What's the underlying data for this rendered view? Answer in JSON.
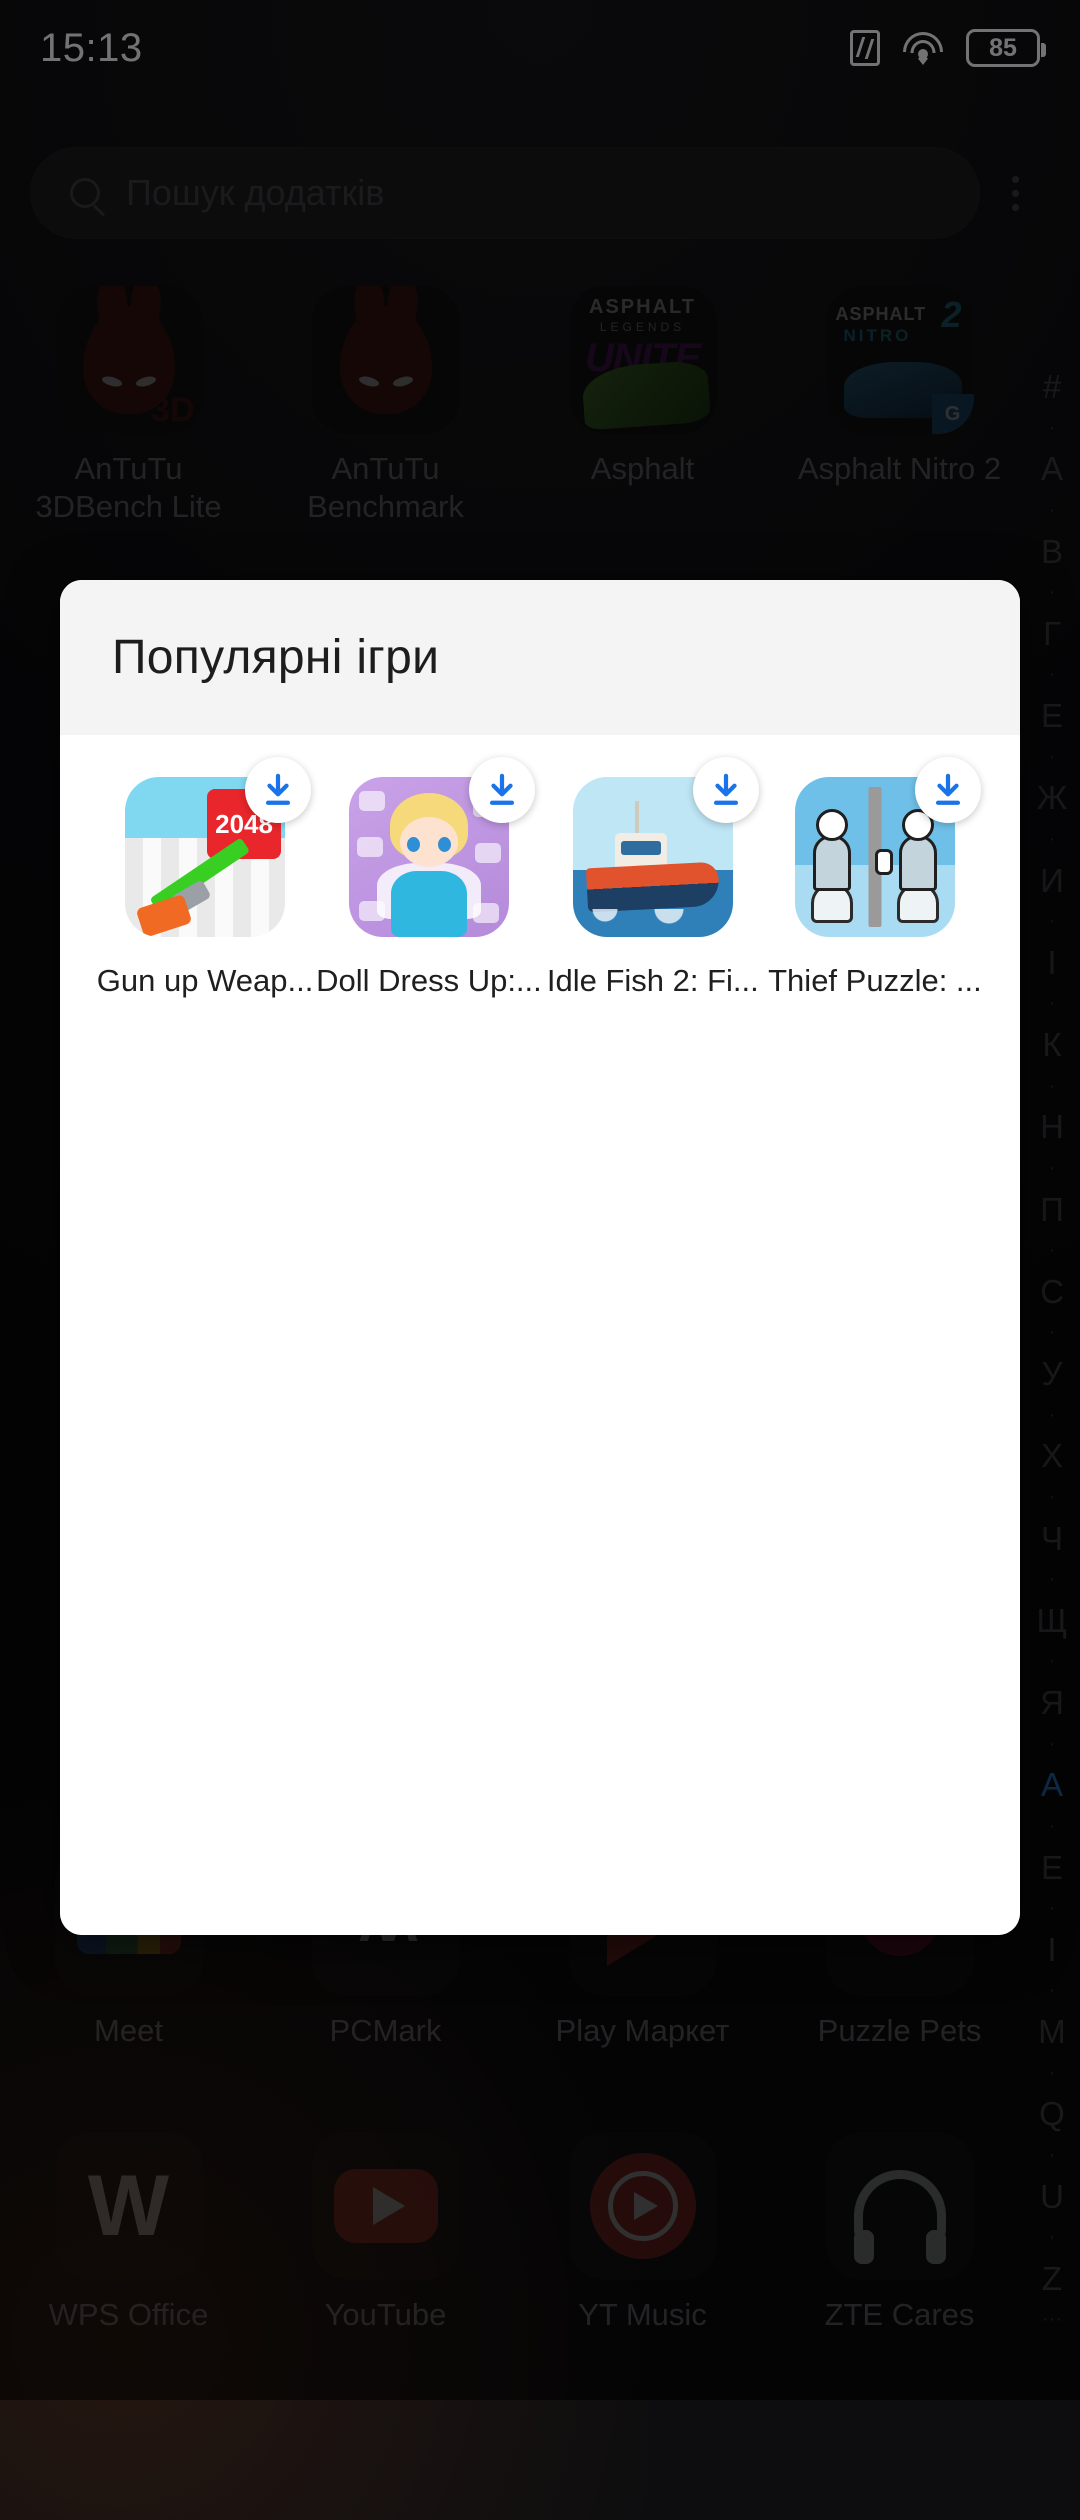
{
  "status_bar": {
    "time": "15:13",
    "nfc_icon": "nfc-icon",
    "wifi_icon": "wifi-icon",
    "battery_percent": "85"
  },
  "search": {
    "placeholder": "Пошук додатків",
    "icon": "search-icon",
    "overflow_icon": "more-options-icon"
  },
  "app_drawer": {
    "row1": [
      {
        "label": "AnTuTu 3DBench Lite",
        "icon": "antutu-3dbench-icon"
      },
      {
        "label": "AnTuTu Benchmark",
        "icon": "antutu-benchmark-icon"
      },
      {
        "label": "Asphalt",
        "icon": "asphalt-legends-unite-icon"
      },
      {
        "label": "Asphalt Nitro 2",
        "icon": "asphalt-nitro-2-icon"
      }
    ],
    "row2": [
      {
        "label": "Meet",
        "icon": "google-meet-icon"
      },
      {
        "label": "PCMark",
        "icon": "pcmark-icon"
      },
      {
        "label": "Play Маркет",
        "icon": "play-store-icon"
      },
      {
        "label": "Puzzle Pets",
        "icon": "puzzle-pets-icon"
      }
    ],
    "row3": [
      {
        "label": "WPS Office",
        "icon": "wps-office-icon"
      },
      {
        "label": "YouTube",
        "icon": "youtube-icon"
      },
      {
        "label": "YT Music",
        "icon": "yt-music-icon"
      },
      {
        "label": "ZTE Cares",
        "icon": "zte-cares-icon"
      }
    ]
  },
  "alpha_index": {
    "selected": "A",
    "selected_color": "#1f5fa8",
    "letters": [
      "#",
      "·",
      "A",
      "·",
      "В",
      "·",
      "Г",
      "·",
      "Е",
      "·",
      "Ж",
      "·",
      "И",
      "·",
      "І",
      "·",
      "К",
      "·",
      "Н",
      "·",
      "П",
      "·",
      "С",
      "·",
      "У",
      "·",
      "Х",
      "·",
      "Ч",
      "·",
      "Щ",
      "·",
      "Я",
      "·",
      "A",
      "·",
      "E",
      "·",
      "I",
      "·",
      "M",
      "·",
      "Q",
      "·",
      "U",
      "·",
      "Z",
      "···"
    ]
  },
  "modal": {
    "title": "Популярні ігри",
    "download_badge_icon": "download-icon",
    "accent_color": "#1a73e8",
    "games": [
      {
        "name": "Gun up Weap...",
        "icon": "gun-up-weapon-icon",
        "badge": "2048"
      },
      {
        "name": "Doll Dress Up:...",
        "icon": "doll-dress-up-icon"
      },
      {
        "name": "Idle Fish 2: Fi...",
        "icon": "idle-fish-2-icon"
      },
      {
        "name": "Thief Puzzle: ...",
        "icon": "thief-puzzle-icon"
      }
    ]
  }
}
